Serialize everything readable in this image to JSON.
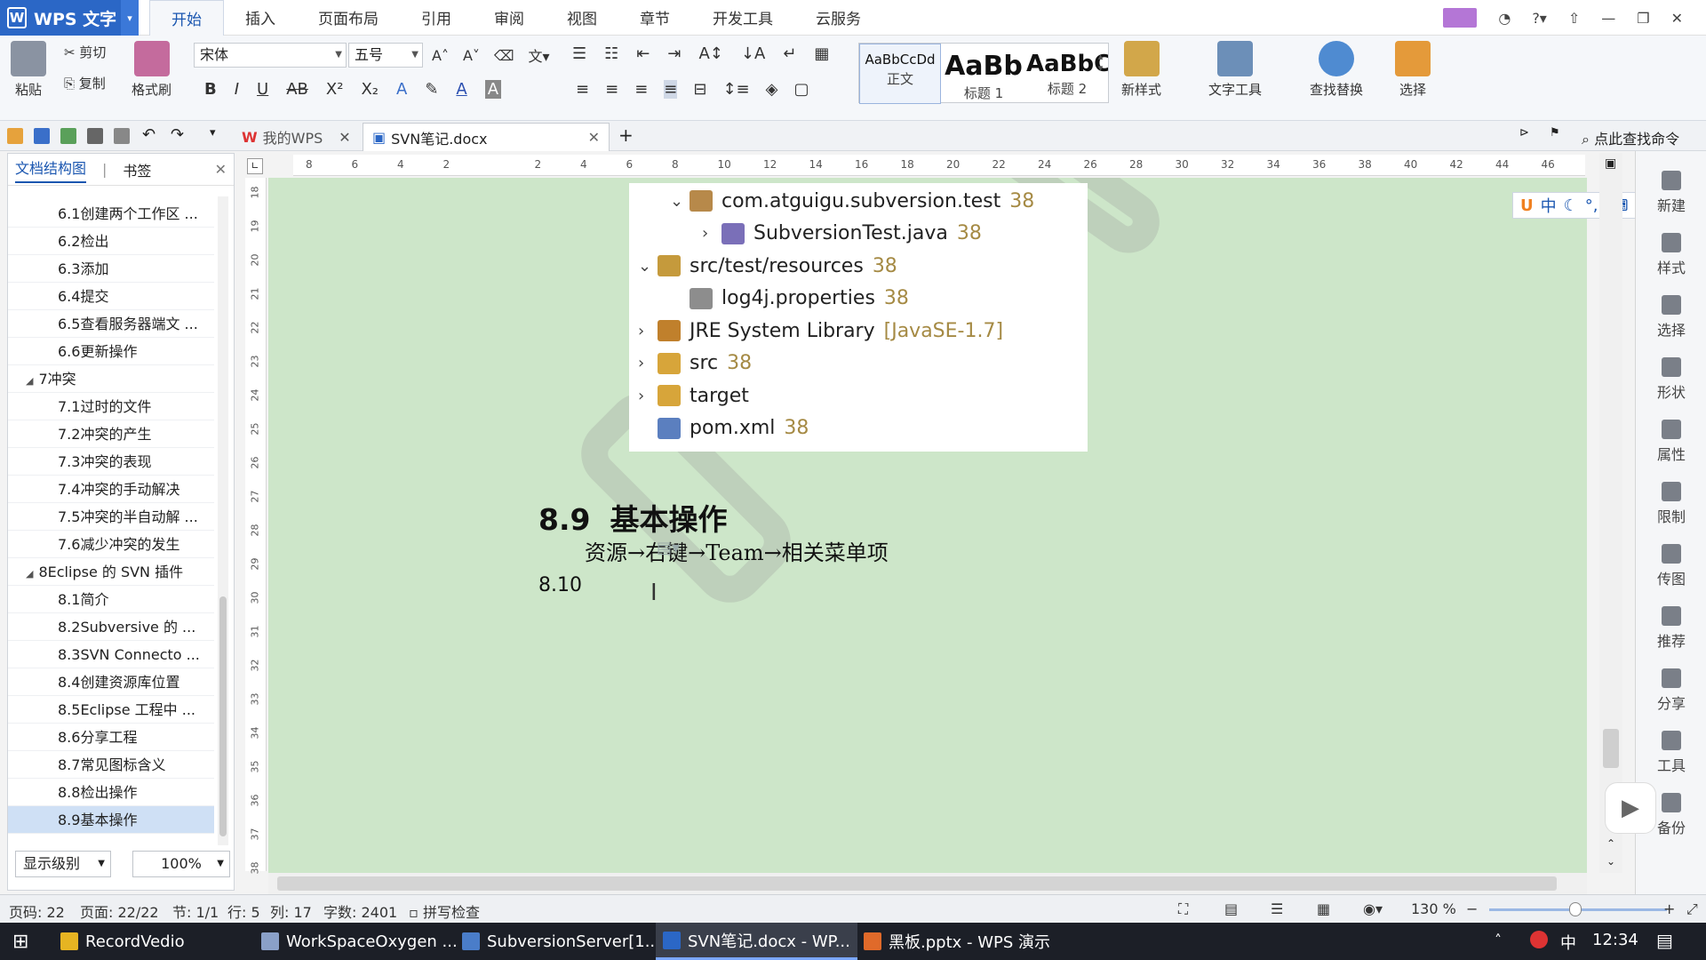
{
  "titlebar": {
    "app_name": "WPS 文字",
    "menu": [
      "开始",
      "插入",
      "页面布局",
      "引用",
      "审阅",
      "视图",
      "章节",
      "开发工具",
      "云服务"
    ],
    "active_menu": "开始"
  },
  "ribbon": {
    "paste": "粘贴",
    "cut": "剪切",
    "copy": "复制",
    "format_painter": "格式刷",
    "font_name": "宋体",
    "font_size": "五号",
    "styles": [
      {
        "preview": "AaBbCcDd",
        "name": "正文"
      },
      {
        "preview": "AaBb",
        "name": "标题 1"
      },
      {
        "preview": "AaBbC",
        "name": "标题 2"
      }
    ],
    "new_style": "新样式",
    "text_tools": "文字工具",
    "find_replace": "查找替换",
    "select": "选择"
  },
  "tabs": {
    "home_tab": "我的WPS",
    "doc_tab": "SVN笔记.docx",
    "find_cmd": "点此查找命令"
  },
  "sidebar": {
    "tab_outline": "文档结构图",
    "tab_bookmark": "书签",
    "items": [
      {
        "label": "6.1创建两个工作区 ...",
        "level": 2
      },
      {
        "label": "6.2检出",
        "level": 2
      },
      {
        "label": "6.3添加",
        "level": 2
      },
      {
        "label": "6.4提交",
        "level": 2
      },
      {
        "label": "6.5查看服务器端文 ...",
        "level": 2
      },
      {
        "label": "6.6更新操作",
        "level": 2
      },
      {
        "label": "7冲突",
        "level": 1
      },
      {
        "label": "7.1过时的文件",
        "level": 2
      },
      {
        "label": "7.2冲突的产生",
        "level": 2
      },
      {
        "label": "7.3冲突的表现",
        "level": 2
      },
      {
        "label": "7.4冲突的手动解决",
        "level": 2
      },
      {
        "label": "7.5冲突的半自动解 ...",
        "level": 2
      },
      {
        "label": "7.6减少冲突的发生",
        "level": 2
      },
      {
        "label": "8Eclipse 的 SVN 插件",
        "level": 1
      },
      {
        "label": "8.1简介",
        "level": 2
      },
      {
        "label": "8.2Subversive 的 ...",
        "level": 2
      },
      {
        "label": "8.3SVN Connecto ...",
        "level": 2
      },
      {
        "label": "8.4创建资源库位置",
        "level": 2
      },
      {
        "label": "8.5Eclipse 工程中 ...",
        "level": 2
      },
      {
        "label": "8.6分享工程",
        "level": 2
      },
      {
        "label": "8.7常见图标含义",
        "level": 2
      },
      {
        "label": "8.8检出操作",
        "level": 2
      },
      {
        "label": "8.9基本操作",
        "level": 2
      }
    ],
    "level_select": "显示级别",
    "zoom_select": "100%"
  },
  "document": {
    "tree": [
      {
        "text": "com.atguigu.subversion.test",
        "ver": "38",
        "arrow": "v",
        "indent": 1
      },
      {
        "text": "SubversionTest.java",
        "ver": "38",
        "arrow": ">",
        "indent": 2
      },
      {
        "text": "src/test/resources",
        "ver": "38",
        "arrow": "v",
        "indent": 0
      },
      {
        "text": "log4j.properties",
        "ver": "38",
        "arrow": "",
        "indent": 1
      },
      {
        "text": "JRE System Library",
        "ver": "[JavaSE-1.7]",
        "arrow": ">",
        "indent": 0
      },
      {
        "text": "src",
        "ver": "38",
        "arrow": ">",
        "indent": 0
      },
      {
        "text": "target",
        "ver": "",
        "arrow": ">",
        "indent": 0
      },
      {
        "text": "pom.xml",
        "ver": "38",
        "arrow": "",
        "indent": 0
      }
    ],
    "heading_num": "8.9",
    "heading_text": "基本操作",
    "para1": "资源→右键→Team→相关菜单项",
    "para2": "8.10"
  },
  "rightpanel": [
    "新建",
    "样式",
    "选择",
    "形状",
    "属性",
    "限制",
    "传图",
    "推荐",
    "分享",
    "工具",
    "备份"
  ],
  "statusbar": {
    "page_code": "页码: 22",
    "page": "页面: 22/22",
    "section": "节: 1/1",
    "row": "行: 5",
    "col": "列: 17",
    "words": "字数: 2401",
    "spell": "拼写检查",
    "zoom": "130 %"
  },
  "taskbar": {
    "items": [
      "RecordVedio",
      "WorkSpaceOxygen ...",
      "SubversionServer[1...",
      "SVN笔记.docx - WP...",
      "黑板.pptx - WPS 演示"
    ],
    "active_index": 3,
    "time": "12:34",
    "ime": "中"
  },
  "colors": {
    "accent": "#2b67c6",
    "page_bg": "#cde6c9"
  }
}
